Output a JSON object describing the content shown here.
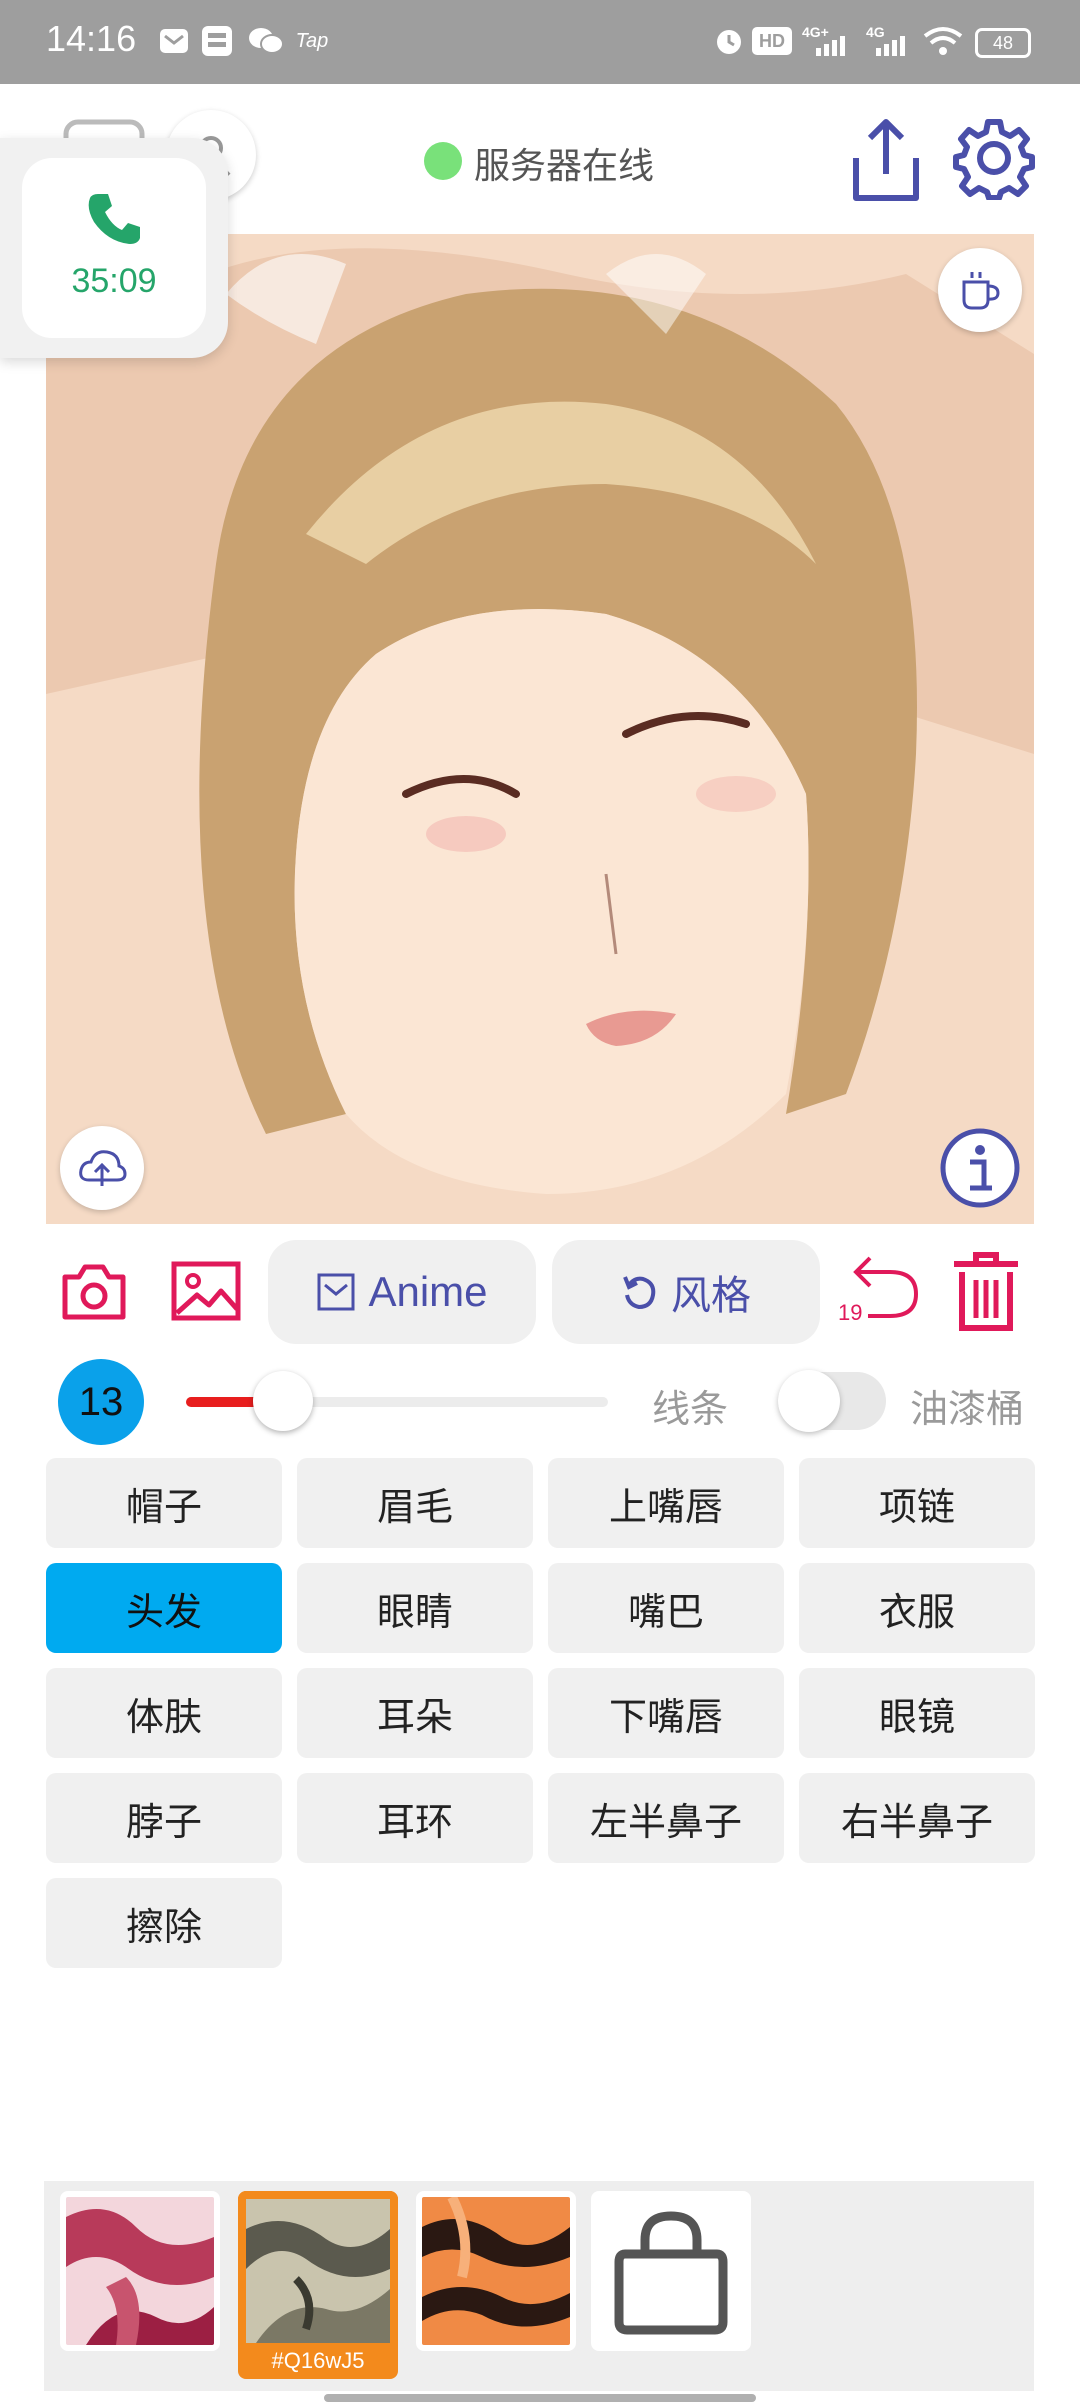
{
  "status_bar": {
    "time": "14:16",
    "icons": [
      "mail-icon",
      "zhihu-app-icon",
      "wechat-icon",
      "taptap-icon",
      "alarm-icon",
      "hd-icon",
      "signal-4g-plus-icon",
      "signal-4g-icon",
      "wifi-icon"
    ],
    "tap_label": "Tap",
    "hd_label": "HD",
    "net1_label": "4G+",
    "net2_label": "4G",
    "battery": "48"
  },
  "header": {
    "server_status": "服务器在线",
    "status_color": "#79e17a"
  },
  "call_bubble": {
    "timer": "35:09"
  },
  "toolbar": {
    "anime_label": "Anime",
    "style_label": "风格",
    "undo_count": "19"
  },
  "brush": {
    "size": "13",
    "slider_fraction": 0.23,
    "line_label": "线条",
    "bucket_label": "油漆桶",
    "bucket_enabled": false
  },
  "labels": [
    {
      "text": "帽子",
      "active": false
    },
    {
      "text": "眉毛",
      "active": false
    },
    {
      "text": "上嘴唇",
      "active": false
    },
    {
      "text": "项链",
      "active": false
    },
    {
      "text": "头发",
      "active": true
    },
    {
      "text": "眼睛",
      "active": false
    },
    {
      "text": "嘴巴",
      "active": false
    },
    {
      "text": "衣服",
      "active": false
    },
    {
      "text": "体肤",
      "active": false
    },
    {
      "text": "耳朵",
      "active": false
    },
    {
      "text": "下嘴唇",
      "active": false
    },
    {
      "text": "眼镜",
      "active": false
    },
    {
      "text": "脖子",
      "active": false
    },
    {
      "text": "耳环",
      "active": false
    },
    {
      "text": "左半鼻子",
      "active": false
    },
    {
      "text": "右半鼻子",
      "active": false
    },
    {
      "text": "擦除",
      "active": false
    }
  ],
  "palette": {
    "selected_code": "#Q16wJ5",
    "colors": {
      "accent": "#4a4fa9",
      "danger": "#e0195a",
      "selected_chip": "#00aaf0",
      "selected_swatch": "#f38a1c"
    }
  }
}
